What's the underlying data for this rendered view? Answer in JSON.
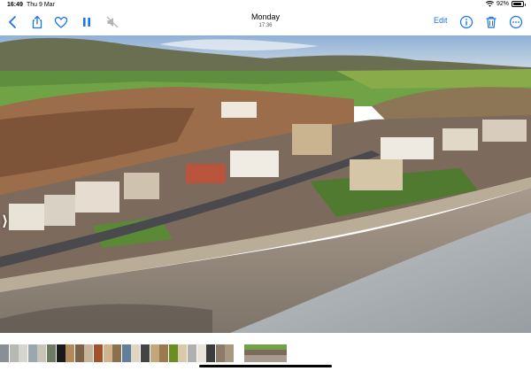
{
  "status_bar": {
    "time": "16:49",
    "date": "Thu 9 Mar",
    "battery_percent": "92%",
    "battery_level": 0.92
  },
  "toolbar": {
    "title": "Monday",
    "subtitle": "17:36",
    "edit_label": "Edit",
    "accent_color": "#1a73e8",
    "icons": [
      "back-chevron-icon",
      "share-icon",
      "heart-icon",
      "pause-icon",
      "muted-speaker-icon",
      "info-icon",
      "trash-icon",
      "more-icon"
    ]
  },
  "photo": {
    "prev_glyph": "⟩"
  },
  "thumbnails": {
    "colors": [
      "#8a8f95",
      "#b7b9b5",
      "#d6d5cf",
      "#9aa7ae",
      "#c9c4b8",
      "#6f7a63",
      "#1a1a1a",
      "#b38a5a",
      "#7d6248",
      "#c8b49a",
      "#a0522d",
      "#d2b48c",
      "#8b6f4e",
      "#5f7f9b",
      "#e0d6c3",
      "#444444",
      "#c2a77b",
      "#9c7a4f",
      "#6b8e23",
      "#d8c9a8",
      "#b0b0b0",
      "#e8e4da",
      "#3c3c3c",
      "#8c7b6a",
      "#a89880"
    ]
  }
}
